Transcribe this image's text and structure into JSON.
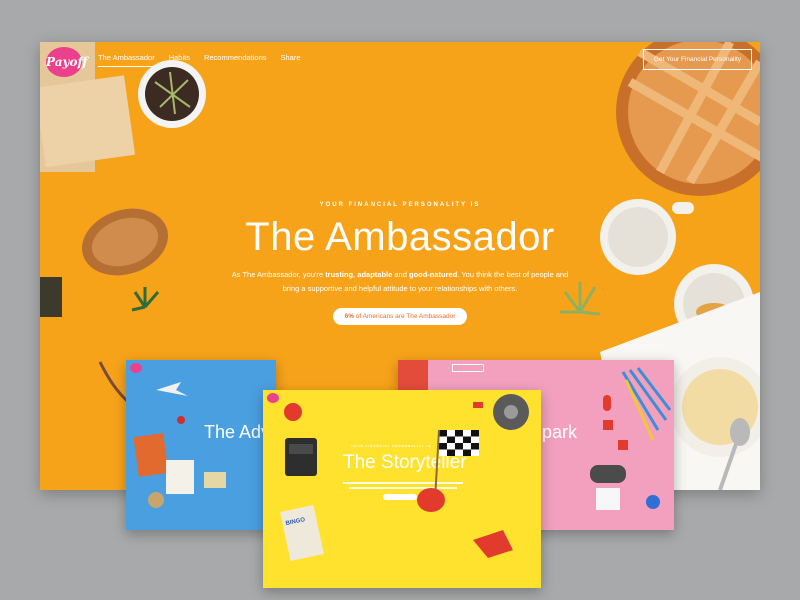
{
  "main": {
    "logo_text": "Payoff",
    "nav": {
      "items": [
        {
          "label": "The Ambassador",
          "active": true
        },
        {
          "label": "Habits",
          "active": false
        },
        {
          "label": "Recommendations",
          "active": false
        },
        {
          "label": "Share",
          "active": false
        }
      ],
      "cta_label": "Get Your Financial Personality"
    },
    "hero": {
      "eyebrow": "YOUR FINANCIAL PERSONALITY IS",
      "title": "The Ambassador",
      "desc_before": "As The Ambassador, you're ",
      "desc_bold1": "trusting",
      "desc_sep1": ", ",
      "desc_bold2": "adaptable",
      "desc_sep2": " and ",
      "desc_bold3": "good-natured",
      "desc_after": ". You think the best of people and bring a supportive and helpful attitude to your relationships with others.",
      "pill_bold": "6%",
      "pill_text": " of Americans are The Ambassador"
    },
    "bg_color": "#f7a31a"
  },
  "thumbnails": {
    "adventurer": {
      "title": "The Adv",
      "bg_color": "#4a9fe0"
    },
    "spark": {
      "title": "park",
      "bg_color": "#f2a0bd"
    },
    "storyteller": {
      "title": "The Storyteller",
      "eyebrow": "YOUR FINANCIAL PERSONALITY IS",
      "bingo_label": "BINGO",
      "bg_color": "#ffe22e"
    }
  },
  "colors": {
    "background": "#a7a9aa",
    "brand_pink": "#ec3f8c"
  }
}
